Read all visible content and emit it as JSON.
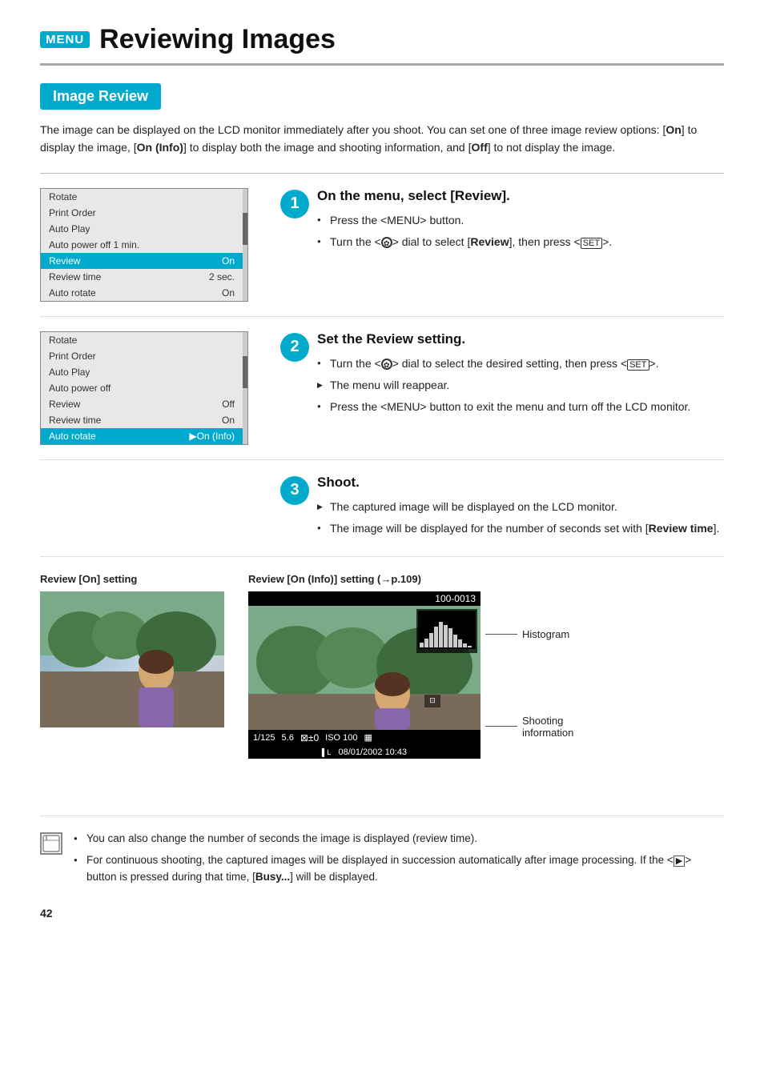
{
  "page": {
    "number": "42",
    "menu_badge": "MENU",
    "title": "Reviewing Images"
  },
  "section": {
    "heading": "Image Review"
  },
  "intro": {
    "text": "The image can be displayed on the LCD monitor immediately after you shoot. You can set one of three image review options: [On] to display the image, [On (Info)] to display both the image and shooting information, and [Off] to not display the image."
  },
  "steps": [
    {
      "number": "1",
      "title": "On the menu, select [Review].",
      "bullets": [
        {
          "type": "bullet",
          "text": "Press the <MENU> button."
        },
        {
          "type": "bullet",
          "text": "Turn the <dial> dial to select [Review], then press <SET>."
        }
      ],
      "menu": {
        "items": [
          {
            "label": "Rotate",
            "value": "",
            "selected": false
          },
          {
            "label": "Print Order",
            "value": "",
            "selected": false
          },
          {
            "label": "Auto Play",
            "value": "",
            "selected": false
          },
          {
            "label": "Auto power off 1 min.",
            "value": "",
            "selected": false
          },
          {
            "label": "Review",
            "value": "On",
            "selected": true
          },
          {
            "label": "Review time",
            "value": "2 sec.",
            "selected": false
          },
          {
            "label": "Auto rotate",
            "value": "On",
            "selected": false
          }
        ]
      }
    },
    {
      "number": "2",
      "title": "Set the Review setting.",
      "bullets": [
        {
          "type": "bullet",
          "text": "Turn the <dial> dial to select the desired setting, then press <SET>."
        },
        {
          "type": "arrow",
          "text": "The menu will reappear."
        },
        {
          "type": "bullet",
          "text": "Press the <MENU> button to exit the menu and turn off the LCD monitor."
        }
      ],
      "menu": {
        "items": [
          {
            "label": "Rotate",
            "value": "",
            "selected": false
          },
          {
            "label": "Print Order",
            "value": "",
            "selected": false
          },
          {
            "label": "Auto Play",
            "value": "",
            "selected": false
          },
          {
            "label": "Auto power off",
            "value": "",
            "selected": false
          },
          {
            "label": "Review",
            "value": "Off",
            "selected": false
          },
          {
            "label": "Review time",
            "value": "On",
            "selected": false
          },
          {
            "label": "Auto rotate",
            "value": "▶On (Info)",
            "selected": true
          }
        ]
      }
    },
    {
      "number": "3",
      "title": "Shoot.",
      "bullets": [
        {
          "type": "arrow",
          "text": "The captured image will be displayed on the LCD monitor."
        },
        {
          "type": "bullet",
          "text": "The image will be displayed for the number of seconds set with [Review time]."
        }
      ]
    }
  ],
  "image_examples": {
    "on_label": "Review [On] setting",
    "on_info_label": "Review [On (Info)] setting (→p.109)",
    "info_details": {
      "image_number": "100-0013",
      "shutter": "1/125",
      "aperture": "5.6",
      "exposure": "±0",
      "iso": "ISO 100",
      "datetime": "08/01/2002 10:43",
      "labels": {
        "histogram": "Histogram",
        "shooting_info": "Shooting information"
      }
    }
  },
  "notes": [
    "You can also change the number of seconds the image is displayed (review time).",
    "For continuous shooting, the captured images will be displayed in succession automatically after image processing. If the <▶> button is pressed during that time, [Busy...] will be displayed."
  ]
}
